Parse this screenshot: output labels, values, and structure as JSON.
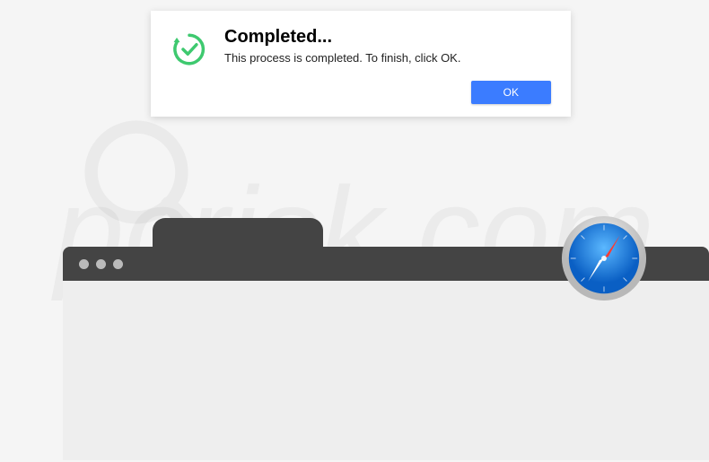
{
  "dialog": {
    "title": "Completed...",
    "message": "This process is completed. To finish, click OK.",
    "ok_label": "OK"
  },
  "watermark": {
    "text": "pcrisk.com"
  },
  "colors": {
    "dialog_bg": "#ffffff",
    "button_bg": "#3b7cff",
    "button_text": "#ffffff",
    "titlebar_bg": "#444444",
    "content_bg": "#eeeeee",
    "icon_green": "#3ec96f"
  },
  "icons": {
    "dialog_icon": "checkmark-sync-icon",
    "app_icon": "safari-compass-icon"
  }
}
